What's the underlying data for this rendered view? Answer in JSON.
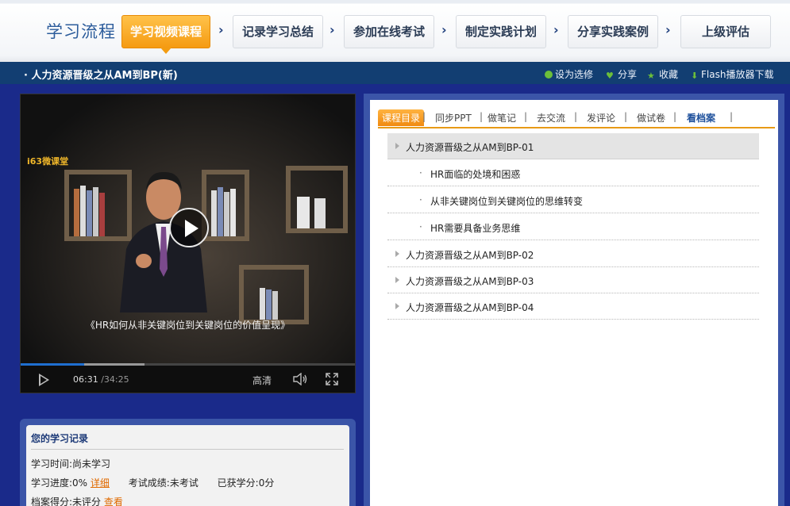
{
  "header": {
    "title": "学习流程",
    "steps": [
      "学习视频课程",
      "记录学习总结",
      "参加在线考试",
      "制定实践计划",
      "分享实践案例",
      "上级评估"
    ],
    "active_step": 0
  },
  "course": {
    "title": "· 人力资源晋级之从AM到BP(新)",
    "actions": [
      {
        "label": "设为选修",
        "icon": "plus-circle-icon"
      },
      {
        "label": "分享",
        "icon": "heart-icon"
      },
      {
        "label": "收藏",
        "icon": "star-icon"
      },
      {
        "label": "Flash播放器下载",
        "icon": "download-icon"
      }
    ]
  },
  "video": {
    "watermark": "i63微课堂",
    "subtitle": "《HR如何从非关键岗位到关键岗位的价值呈现》",
    "current_time": "06:31",
    "duration": "/34:25",
    "quality": "高清",
    "progress": 0.19,
    "buffered": 0.37
  },
  "record": {
    "title": "您的学习记录",
    "time_label": "学习时间:",
    "time_value": "尚未学习",
    "progress_label": "学习进度:",
    "progress_value": "0%",
    "detail_link": "详细",
    "exam_label": "考试成绩:",
    "exam_value": "未考试",
    "credit_label": "已获学分:",
    "credit_value": "0分",
    "archive_label": "档案得分:",
    "archive_value": "未评分",
    "view_link": "查看"
  },
  "panel": {
    "tabs": [
      "课程目录",
      "同步PPT",
      "做笔记",
      "去交流",
      "发评论",
      "做试卷",
      "看档案"
    ],
    "toc": [
      {
        "label": "人力资源晋级之从AM到BP-01",
        "level": 0,
        "selected": true
      },
      {
        "label": "HR面临的处境和困惑",
        "level": 1
      },
      {
        "label": "从非关键岗位到关键岗位的思维转变",
        "level": 1
      },
      {
        "label": "HR需要具备业务思维",
        "level": 1
      },
      {
        "label": "人力资源晋级之从AM到BP-02",
        "level": 0
      },
      {
        "label": "人力资源晋级之从AM到BP-03",
        "level": 0
      },
      {
        "label": "人力资源晋级之从AM到BP-04",
        "level": 0
      }
    ]
  },
  "colors": {
    "accent": "#f39c12",
    "nav_blue": "#123e72",
    "frame_blue": "#3b55a8",
    "background": "#1a2a8a"
  }
}
